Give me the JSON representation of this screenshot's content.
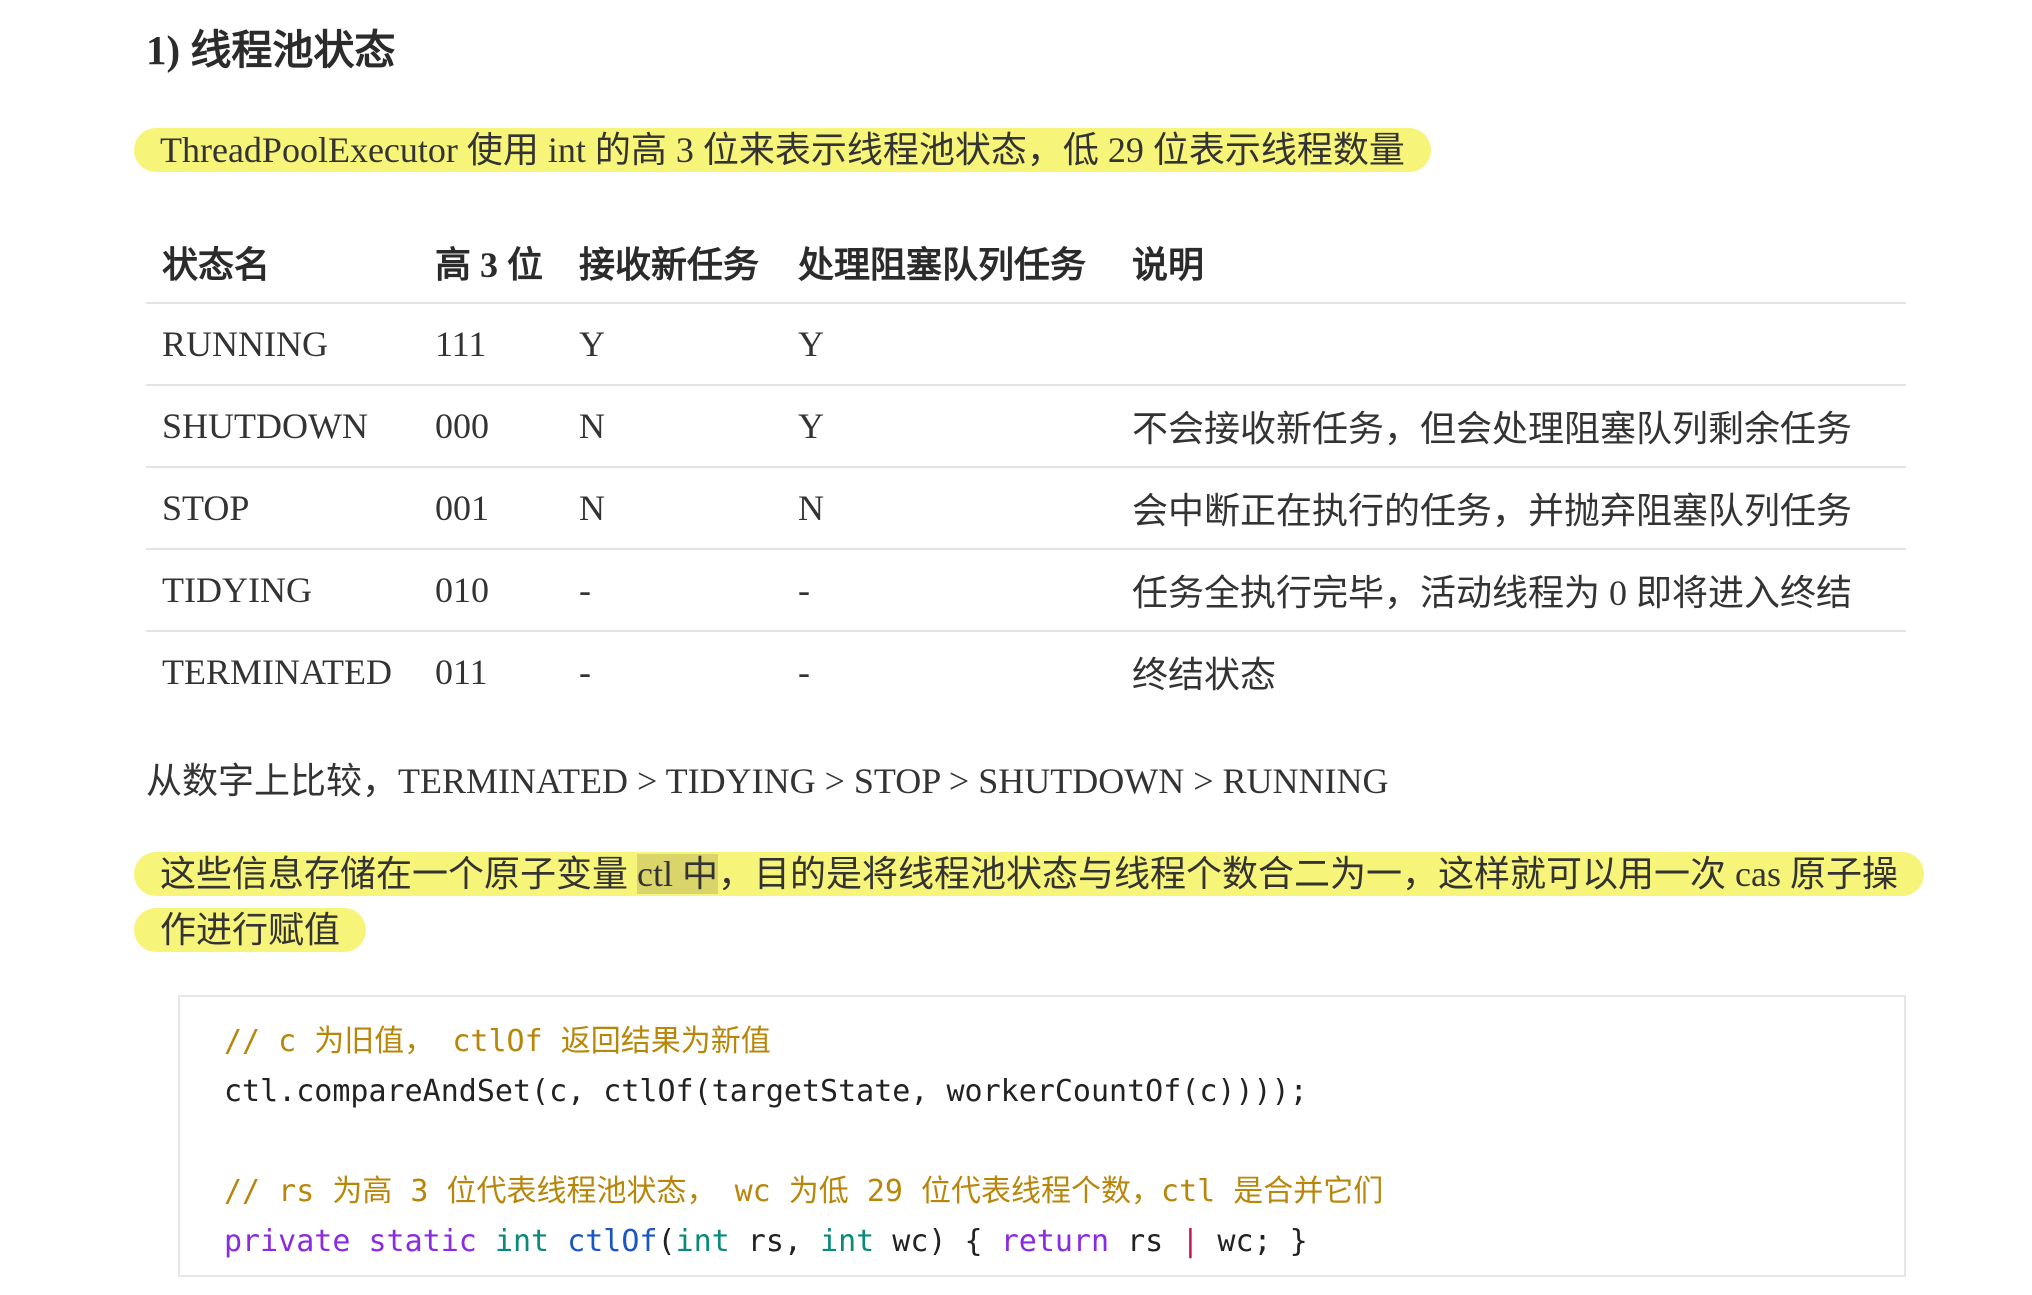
{
  "heading": "1) 线程池状态",
  "intro": "ThreadPoolExecutor 使用 int 的高 3 位来表示线程池状态，低 29 位表示线程数量",
  "table": {
    "headers": [
      "状态名",
      "高 3 位",
      "接收新任务",
      "处理阻塞队列任务",
      "说明"
    ],
    "rows": [
      [
        "RUNNING",
        "111",
        "Y",
        "Y",
        ""
      ],
      [
        "SHUTDOWN",
        "000",
        "N",
        "Y",
        "不会接收新任务，但会处理阻塞队列剩余任务"
      ],
      [
        "STOP",
        "001",
        "N",
        "N",
        "会中断正在执行的任务，并抛弃阻塞队列任务"
      ],
      [
        "TIDYING",
        "010",
        "-",
        "-",
        "任务全执行完毕，活动线程为 0 即将进入终结"
      ],
      [
        "TERMINATED",
        "011",
        "-",
        "-",
        "终结状态"
      ]
    ]
  },
  "compare": "从数字上比较，TERMINATED > TIDYING > STOP > SHUTDOWN > RUNNING",
  "para": {
    "before": "这些信息存储在一个原子变量 ",
    "mark": "ctl 中",
    "after": "，目的是将线程池状态与线程个数合二为一，这样就可以用一次 cas 原子操作进行赋值"
  },
  "code": {
    "line1_comment": "// c 为旧值， ctlOf 返回结果为新值",
    "line2": "ctl.compareAndSet(c, ctlOf(targetState, workerCountOf(c))));",
    "line4_comment": "// rs 为高 3 位代表线程池状态， wc 为低 29 位代表线程个数，ctl 是合并它们",
    "line5": {
      "kw1": "private",
      "kw2": "static",
      "type1": "int",
      "fn": "ctlOf",
      "paren_open": "(",
      "type2": "int",
      "p1": " rs, ",
      "type3": "int",
      "p2": " wc) { ",
      "kw3": "return",
      "p3": " rs ",
      "op": "|",
      "p4": " wc; }"
    }
  },
  "colors": {
    "highlight": "#f7f47a",
    "code_comment": "#b8860b",
    "code_keyword": "#8a2be2",
    "code_type": "#0a8a78",
    "code_function": "#1a56c4"
  }
}
